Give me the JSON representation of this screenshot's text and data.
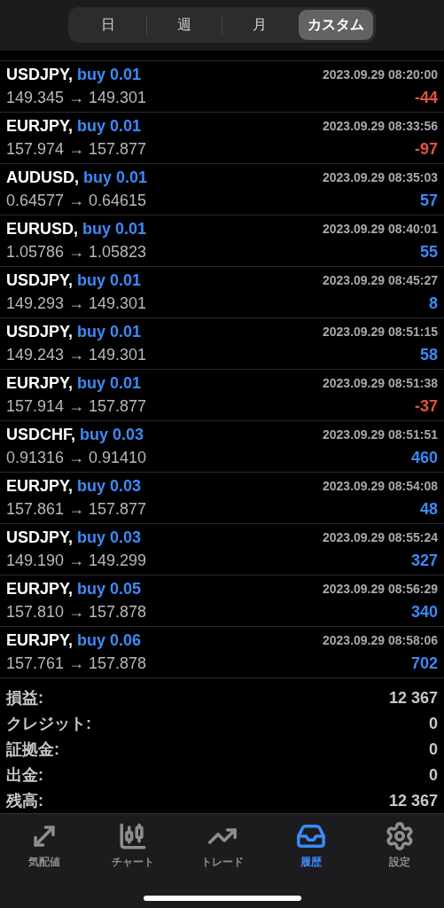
{
  "segments": [
    {
      "label": "日",
      "selected": false
    },
    {
      "label": "週",
      "selected": false
    },
    {
      "label": "月",
      "selected": false
    },
    {
      "label": "カスタム",
      "selected": true
    }
  ],
  "deals": [
    {
      "symbol": "USDJPY,",
      "order": "buy 0.01",
      "time": "2023.09.29 08:20:00",
      "prices": "149.345 → 149.301",
      "profit": "-44",
      "color": "#e5533d"
    },
    {
      "symbol": "EURJPY,",
      "order": "buy 0.01",
      "time": "2023.09.29 08:33:56",
      "prices": "157.974 → 157.877",
      "profit": "-97",
      "color": "#e5533d"
    },
    {
      "symbol": "AUDUSD,",
      "order": "buy 0.01",
      "time": "2023.09.29 08:35:03",
      "prices": "0.64577 → 0.64615",
      "profit": "57",
      "color": "#3d8af7"
    },
    {
      "symbol": "EURUSD,",
      "order": "buy 0.01",
      "time": "2023.09.29 08:40:01",
      "prices": "1.05786 → 1.05823",
      "profit": "55",
      "color": "#3d8af7"
    },
    {
      "symbol": "USDJPY,",
      "order": "buy 0.01",
      "time": "2023.09.29 08:45:27",
      "prices": "149.293 → 149.301",
      "profit": "8",
      "color": "#3d8af7"
    },
    {
      "symbol": "USDJPY,",
      "order": "buy 0.01",
      "time": "2023.09.29 08:51:15",
      "prices": "149.243 → 149.301",
      "profit": "58",
      "color": "#3d8af7"
    },
    {
      "symbol": "EURJPY,",
      "order": "buy 0.01",
      "time": "2023.09.29 08:51:38",
      "prices": "157.914 → 157.877",
      "profit": "-37",
      "color": "#e5533d"
    },
    {
      "symbol": "USDCHF,",
      "order": "buy 0.03",
      "time": "2023.09.29 08:51:51",
      "prices": "0.91316 → 0.91410",
      "profit": "460",
      "color": "#3d8af7"
    },
    {
      "symbol": "EURJPY,",
      "order": "buy 0.03",
      "time": "2023.09.29 08:54:08",
      "prices": "157.861 → 157.877",
      "profit": "48",
      "color": "#3d8af7"
    },
    {
      "symbol": "USDJPY,",
      "order": "buy 0.03",
      "time": "2023.09.29 08:55:24",
      "prices": "149.190 → 149.299",
      "profit": "327",
      "color": "#3d8af7"
    },
    {
      "symbol": "EURJPY,",
      "order": "buy 0.05",
      "time": "2023.09.29 08:56:29",
      "prices": "157.810 → 157.878",
      "profit": "340",
      "color": "#3d8af7"
    },
    {
      "symbol": "EURJPY,",
      "order": "buy 0.06",
      "time": "2023.09.29 08:58:06",
      "prices": "157.761 → 157.878",
      "profit": "702",
      "color": "#3d8af7"
    }
  ],
  "summary": [
    {
      "label": "損益:",
      "value": "12 367"
    },
    {
      "label": "クレジット:",
      "value": "0"
    },
    {
      "label": "証拠金:",
      "value": "0"
    },
    {
      "label": "出金:",
      "value": "0"
    },
    {
      "label": "残高:",
      "value": "12 367"
    }
  ],
  "tab_bar": [
    {
      "label": "気配値",
      "selected": false
    },
    {
      "label": "チャート",
      "selected": false
    },
    {
      "label": "トレード",
      "selected": false
    },
    {
      "label": "履歴",
      "selected": true
    },
    {
      "label": "設定",
      "selected": false
    }
  ]
}
